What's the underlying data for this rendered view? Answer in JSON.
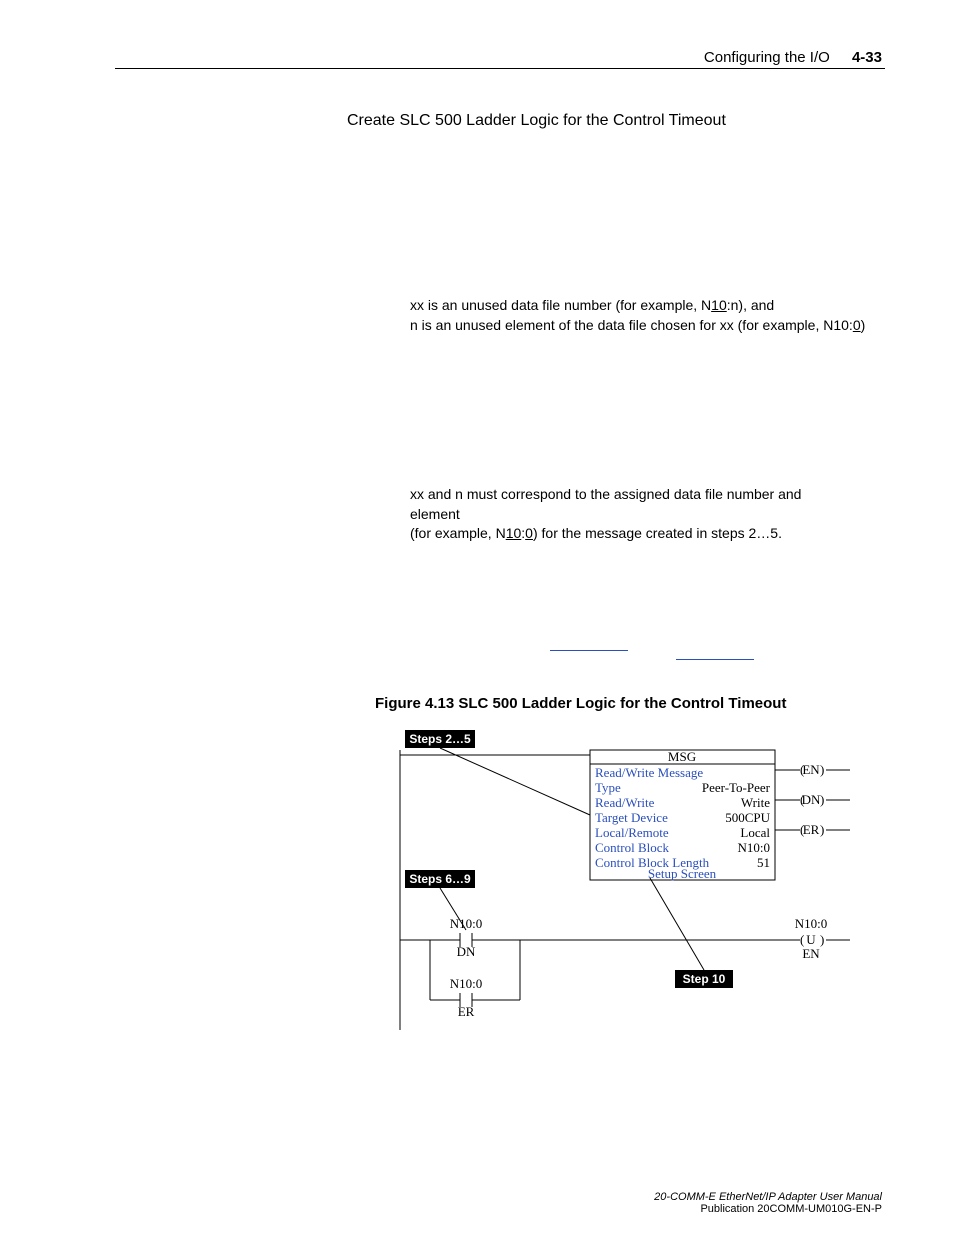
{
  "header": {
    "section": "Configuring the I/O",
    "page": "4-33"
  },
  "title": "Create SLC 500 Ladder Logic for the Control Timeout",
  "note1": {
    "line1a": "xx is an unused data file number (for example, N",
    "line1u": "10",
    "line1b": ":n), and",
    "line2a": "n is an unused element of the data file chosen for xx (for example, N10:",
    "line2u": "0",
    "line2b": ")"
  },
  "note2": {
    "line1": "xx and n must correspond to the assigned data file number and element",
    "line2a": "(for example, N",
    "line2ua": "10",
    "line2b": ":",
    "line2ub": "0",
    "line2c": ") for the message created in steps 2…5."
  },
  "figure": {
    "caption": "Figure 4.13   SLC 500 Ladder Logic for the Control Timeout"
  },
  "diagram": {
    "tags": {
      "a": "Steps 2…5",
      "b": "Steps 6…9",
      "c": "Step 10"
    },
    "msg": {
      "title": "MSG",
      "header": "Read/Write Message",
      "rows": [
        {
          "k": "Type",
          "v": "Peer-To-Peer"
        },
        {
          "k": "Read/Write",
          "v": "Write"
        },
        {
          "k": "Target Device",
          "v": "500CPU"
        },
        {
          "k": "Local/Remote",
          "v": "Local"
        },
        {
          "k": "Control Block",
          "v": "N10:0"
        },
        {
          "k": "Control Block Length",
          "v": "51"
        }
      ],
      "setup": "Setup Screen"
    },
    "contacts": {
      "c1_top": "N10:0",
      "c1_bot": "DN",
      "c2_top": "N10:0",
      "c2_bot": "ER"
    },
    "coils": {
      "en": "EN",
      "dn": "DN",
      "er": "ER",
      "u_top": "N10:0",
      "u_mid": "U",
      "u_bot": "EN"
    }
  },
  "footer": {
    "line1": "20-COMM-E EtherNet/IP Adapter User Manual",
    "line2": "Publication 20COMM-UM010G-EN-P"
  }
}
